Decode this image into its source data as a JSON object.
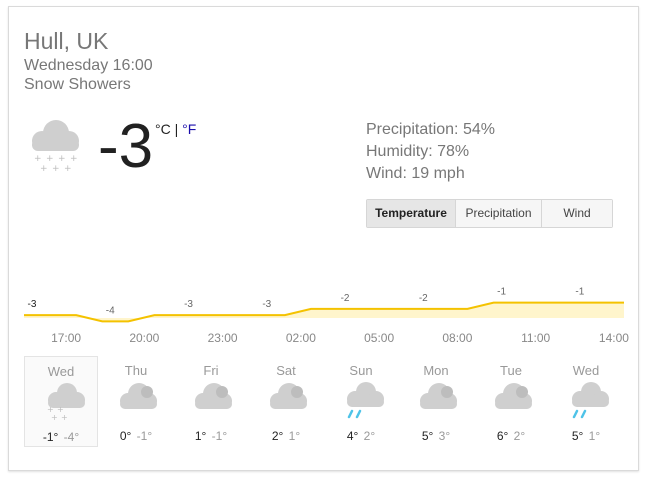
{
  "location": "Hull, UK",
  "datetime": "Wednesday 16:00",
  "condition": "Snow Showers",
  "current": {
    "temp": "-3",
    "unit_c": "°C",
    "unit_sep": " | ",
    "unit_f": "°F",
    "icon": "cloud-snow-icon"
  },
  "details": {
    "precipitation": "Precipitation: 54%",
    "humidity": "Humidity: 78%",
    "wind": "Wind: 19 mph"
  },
  "tabs": [
    "Temperature",
    "Precipitation",
    "Wind"
  ],
  "selected_tab": "Temperature",
  "colors": {
    "line": "#f4c200",
    "fill": "#fff5cc",
    "rain": "#4fc3e8"
  },
  "chart_data": {
    "type": "area",
    "x": [
      "16:00",
      "17:00",
      "18:00",
      "19:00",
      "20:00",
      "21:00",
      "22:00",
      "23:00",
      "00:00",
      "01:00",
      "02:00",
      "03:00",
      "04:00",
      "05:00",
      "06:00",
      "07:00",
      "08:00",
      "09:00",
      "10:00",
      "11:00",
      "12:00",
      "13:00",
      "14:00",
      "15:00"
    ],
    "y": [
      -3,
      -3,
      -3,
      -4,
      -4,
      -3,
      -3,
      -3,
      -3,
      -3,
      -3,
      -2,
      -2,
      -2,
      -2,
      -2,
      -2,
      -2,
      -1,
      -1,
      -1,
      -1,
      -1,
      -1
    ],
    "data_labels": [
      {
        "x": "16:00",
        "label": "-3"
      },
      {
        "x": "19:00",
        "label": "-4"
      },
      {
        "x": "22:00",
        "label": "-3"
      },
      {
        "x": "01:00",
        "label": "-3"
      },
      {
        "x": "04:00",
        "label": "-2"
      },
      {
        "x": "07:00",
        "label": "-2"
      },
      {
        "x": "10:00",
        "label": "-1"
      },
      {
        "x": "13:00",
        "label": "-1"
      }
    ],
    "tick_labels": [
      "17:00",
      "20:00",
      "23:00",
      "02:00",
      "05:00",
      "08:00",
      "11:00",
      "14:00"
    ]
  },
  "forecast": [
    {
      "day": "Wed",
      "high": "-1°",
      "low": "-4°",
      "icon": "cloud-snow-icon"
    },
    {
      "day": "Thu",
      "high": "0°",
      "low": "-1°",
      "icon": "cloud-icon"
    },
    {
      "day": "Fri",
      "high": "1°",
      "low": "-1°",
      "icon": "cloud-icon"
    },
    {
      "day": "Sat",
      "high": "2°",
      "low": "1°",
      "icon": "cloud-icon"
    },
    {
      "day": "Sun",
      "high": "4°",
      "low": "2°",
      "icon": "cloud-rain-icon"
    },
    {
      "day": "Mon",
      "high": "5°",
      "low": "3°",
      "icon": "cloud-icon"
    },
    {
      "day": "Tue",
      "high": "6°",
      "low": "2°",
      "icon": "cloud-icon"
    },
    {
      "day": "Wed",
      "high": "5°",
      "low": "1°",
      "icon": "cloud-rain-icon"
    }
  ]
}
